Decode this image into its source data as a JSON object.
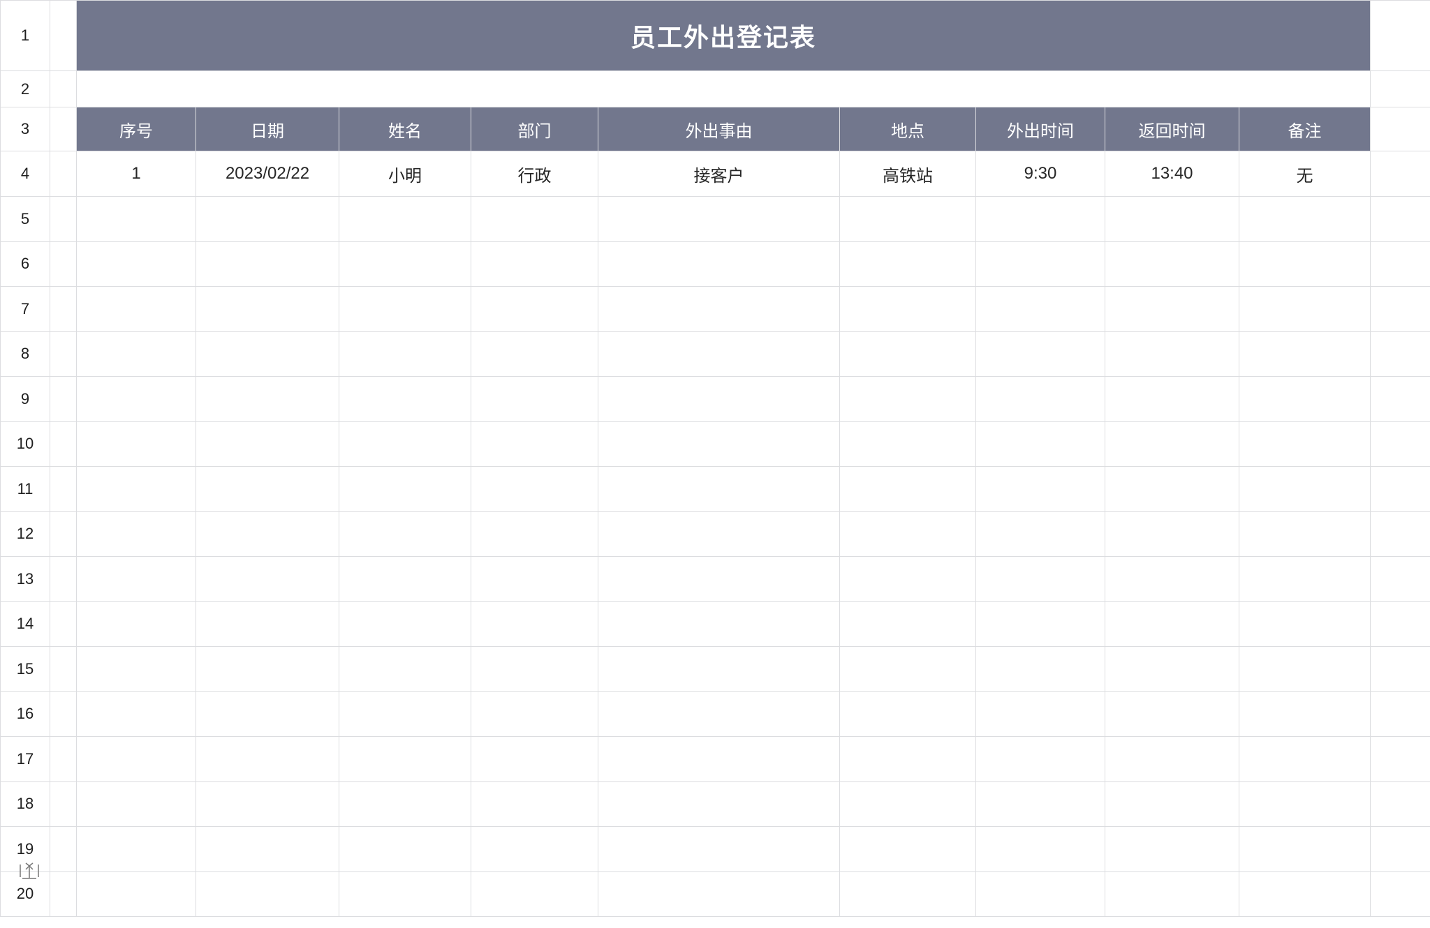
{
  "title": "员工外出登记表",
  "row_numbers": [
    "1",
    "2",
    "3",
    "4",
    "5",
    "6",
    "7",
    "8",
    "9",
    "10",
    "11",
    "12",
    "13",
    "14",
    "15",
    "16",
    "17",
    "18",
    "19",
    "20"
  ],
  "headers": [
    "序号",
    "日期",
    "姓名",
    "部门",
    "外出事由",
    "地点",
    "外出时间",
    "返回时间",
    "备注"
  ],
  "rows": [
    [
      "1",
      "2023/02/22",
      "小明",
      "行政",
      "接客户",
      "高铁站",
      "9:30",
      "13:40",
      "无"
    ]
  ],
  "colors": {
    "header_bg": "#72778d",
    "header_text": "#ffffff",
    "grid_line": "#dcdde0"
  },
  "icons": {
    "row_resize": "row-resize-icon"
  }
}
